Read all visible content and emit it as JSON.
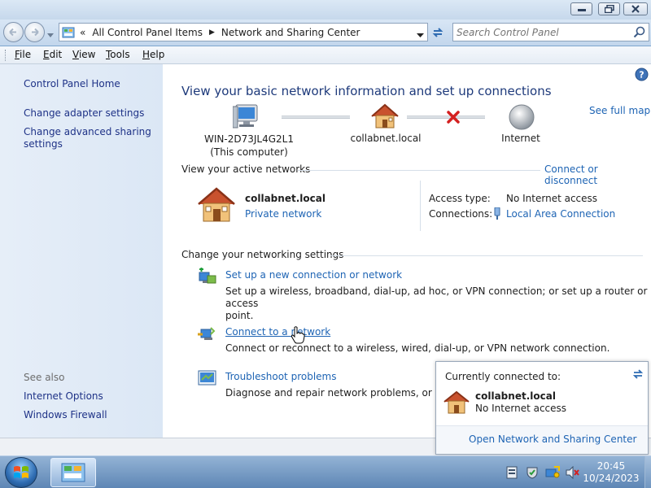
{
  "window": {
    "controls": [
      "minimize",
      "maximize",
      "close"
    ]
  },
  "nav": {
    "breadcrumb_prefix": "«",
    "breadcrumb_1": "All Control Panel Items",
    "breadcrumb_sep": "▶",
    "breadcrumb_2": "Network and Sharing Center",
    "search_placeholder": "Search Control Panel"
  },
  "menu": {
    "items": [
      {
        "accel": "F",
        "rest": "ile"
      },
      {
        "accel": "E",
        "rest": "dit"
      },
      {
        "accel": "V",
        "rest": "iew"
      },
      {
        "accel": "T",
        "rest": "ools"
      },
      {
        "accel": "H",
        "rest": "elp"
      }
    ]
  },
  "sidebar": {
    "home": "Control Panel Home",
    "adapter": "Change adapter settings",
    "advanced_line1": "Change advanced sharing",
    "advanced_line2": "settings",
    "see_also": "See also",
    "internet_options": "Internet Options",
    "firewall": "Windows Firewall"
  },
  "main": {
    "title": "View your basic network information and set up connections",
    "see_full_map": "See full map",
    "map": {
      "computer_name": "WIN-2D73JL4G2L1",
      "computer_note": "(This computer)",
      "network_name": "collabnet.local",
      "internet": "Internet"
    },
    "active": {
      "heading": "View your active networks",
      "connect_disconnect": "Connect or disconnect",
      "network_name": "collabnet.local",
      "network_type": "Private network",
      "access_label": "Access type:",
      "access_value": "No Internet access",
      "connections_label": "Connections:",
      "connections_value": "Local Area Connection"
    },
    "settings": {
      "heading": "Change your networking settings",
      "items": [
        {
          "title": "Set up a new connection or network",
          "desc_line1": "Set up a wireless, broadband, dial-up, ad hoc, or VPN connection; or set up a router or access",
          "desc_line2": "point."
        },
        {
          "title": "Connect to a network",
          "desc_line1": "Connect or reconnect to a wireless, wired, dial-up, or VPN network connection."
        },
        {
          "title": "Troubleshoot problems",
          "desc_line1": "Diagnose and repair network problems, or get tro"
        }
      ]
    }
  },
  "popup": {
    "heading": "Currently connected to:",
    "network_name": "collabnet.local",
    "network_status": "No Internet access",
    "open_link": "Open Network and Sharing Center"
  },
  "taskbar": {
    "time": "20:45",
    "date": "10/24/2023"
  },
  "colors": {
    "link": "#1e64b4",
    "heading": "#1e3a7b",
    "sidebar_bg": "#e6eef8",
    "taskbar": "#5e86b5",
    "error_x": "#d42020"
  }
}
